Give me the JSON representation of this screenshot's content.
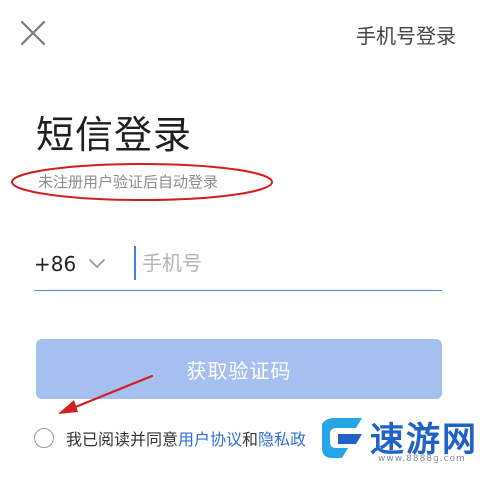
{
  "header": {
    "close_icon": "close-icon",
    "switch_login_label": "手机号登录"
  },
  "main": {
    "title": "短信登录",
    "subtitle": "未注册用户验证后自动登录"
  },
  "phone": {
    "country_code": "+86",
    "country_code_icon": "chevron-down-icon",
    "placeholder": "手机号",
    "value": ""
  },
  "actions": {
    "get_code_label": "获取验证码"
  },
  "agreement": {
    "prefix": "我已阅读并同意",
    "user_agreement": "用户协议",
    "conjunction": "和",
    "privacy_partial": "隐私政"
  },
  "watermark": {
    "name": "速游网",
    "url": "www.8888g.com"
  },
  "colors": {
    "primary_button_disabled": "#a6bff1",
    "link": "#2f6fd8",
    "annotation": "#d21f1f",
    "input_underline": "#5b8bd6"
  }
}
